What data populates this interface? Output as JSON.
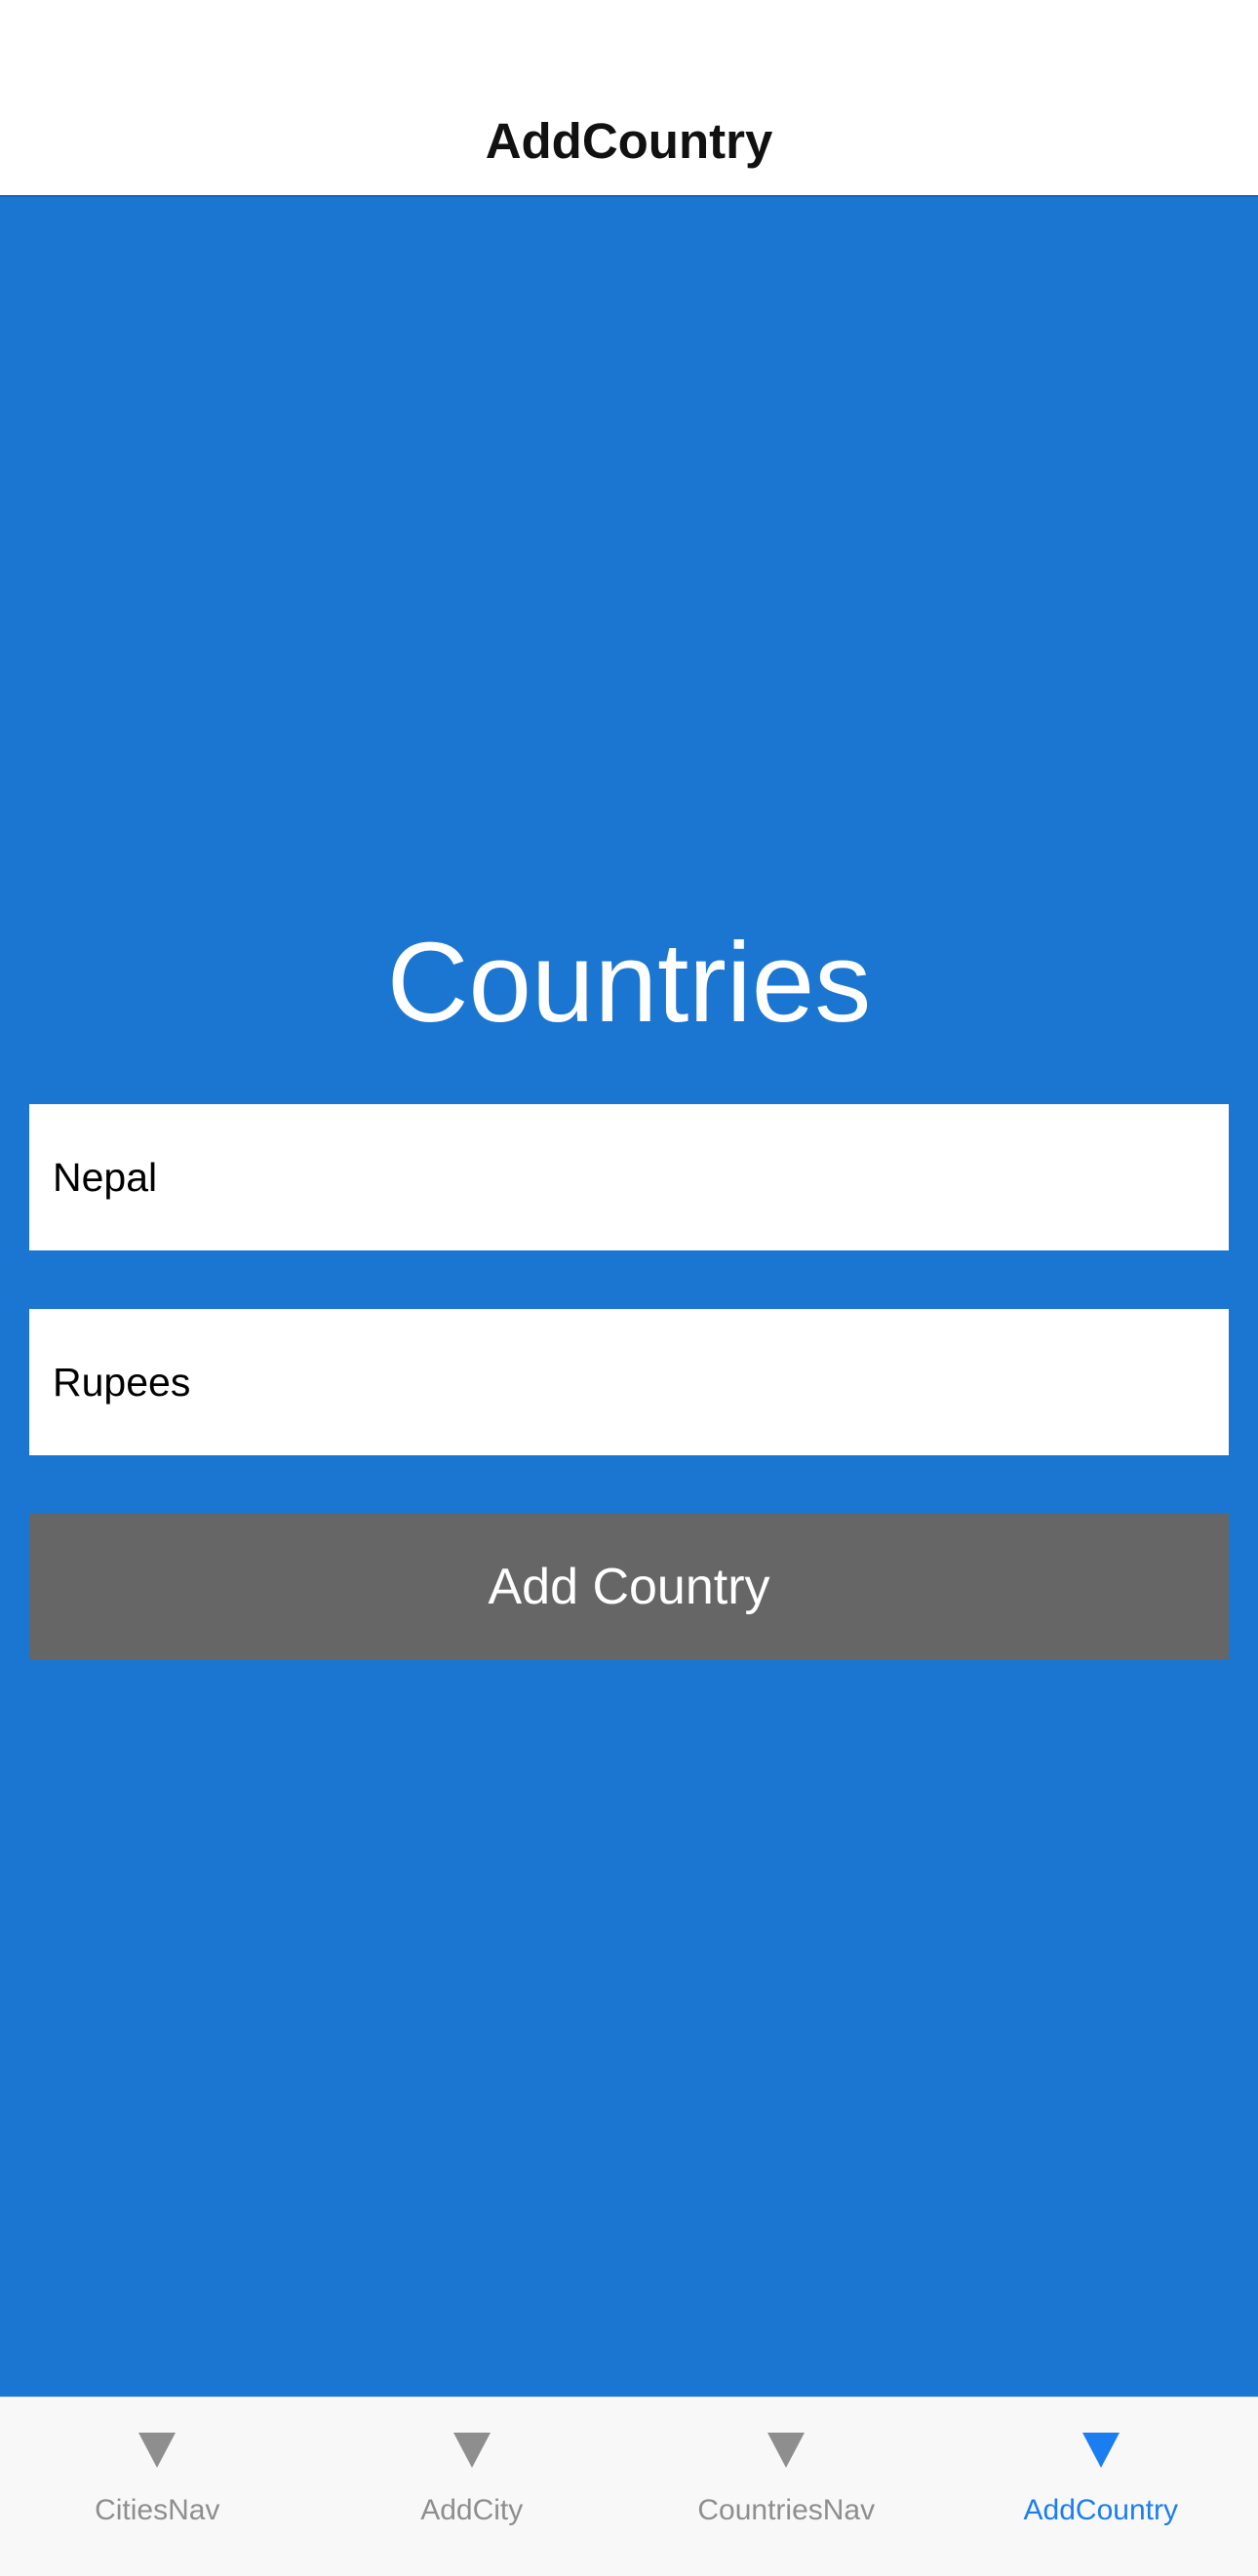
{
  "header": {
    "title": "AddCountry"
  },
  "main": {
    "title": "Countries",
    "country_input": {
      "value": "Nepal",
      "placeholder": ""
    },
    "currency_input": {
      "value": "Rupees",
      "placeholder": ""
    },
    "add_button_label": "Add Country"
  },
  "tabbar": {
    "tabs": [
      {
        "label": "CitiesNav",
        "icon": "triangle-down-icon",
        "active": false
      },
      {
        "label": "AddCity",
        "icon": "triangle-down-icon",
        "active": false
      },
      {
        "label": "CountriesNav",
        "icon": "triangle-down-icon",
        "active": false
      },
      {
        "label": "AddCountry",
        "icon": "triangle-down-icon",
        "active": true
      }
    ]
  },
  "colors": {
    "background": "#1b76d2",
    "button": "#666666",
    "tab_active": "#1a7ef0",
    "tab_inactive": "#8e8e8e"
  }
}
